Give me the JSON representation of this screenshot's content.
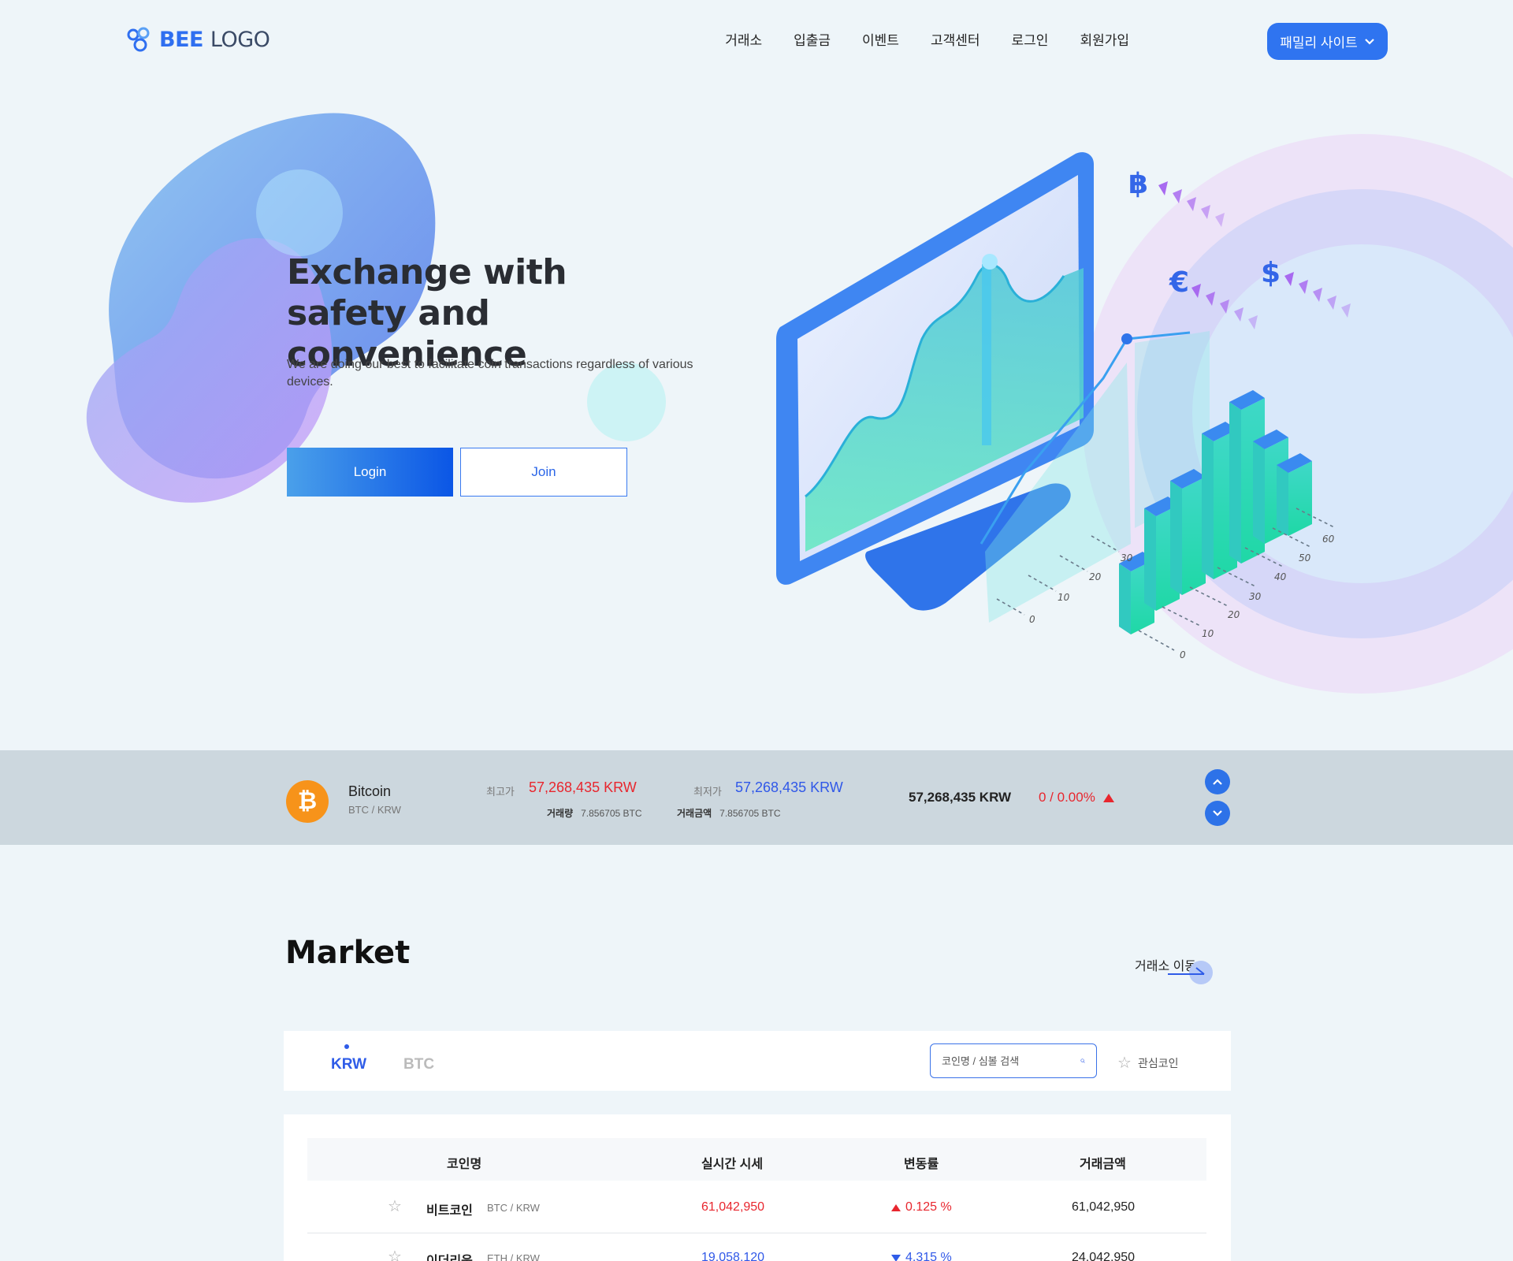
{
  "header": {
    "logo": {
      "bold": "BEE",
      "thin": "LOGO"
    },
    "nav": [
      "거래소",
      "입출금",
      "이벤트",
      "고객센터",
      "로그인",
      "회원가입"
    ],
    "family_site": "패밀리 사이트"
  },
  "hero": {
    "title_line1": "Exchange with",
    "title_line2": "safety and convenience",
    "subtitle": "We are doing our best to facilitate coin transactions regardless of various devices.",
    "login": "Login",
    "join": "Join",
    "axis_left": [
      "0",
      "10",
      "20",
      "30"
    ],
    "axis_right": [
      "0",
      "10",
      "20",
      "30",
      "40",
      "50",
      "60"
    ],
    "currency_symbols": [
      "฿",
      "€",
      "$"
    ]
  },
  "ticker": {
    "name": "Bitcoin",
    "pair": "BTC / KRW",
    "high_label": "최고가",
    "high_value": "57,268,435 KRW",
    "low_label": "최저가",
    "low_value": "57,268,435 KRW",
    "volume_label": "거래량",
    "volume_value": "7.856705 BTC",
    "amount_label": "거래금액",
    "amount_value": "7.856705 BTC",
    "price": "57,268,435 KRW",
    "change": "0 / 0.00%"
  },
  "market": {
    "title": "Market",
    "go_link": "거래소 이동",
    "tabs": [
      "KRW",
      "BTC"
    ],
    "search_placeholder": "코인명 / 심볼 검색",
    "favorites": "관심코인",
    "columns": [
      "코인명",
      "실시간 시세",
      "변동률",
      "거래금액"
    ],
    "rows": [
      {
        "name": "비트코인",
        "pair": "BTC / KRW",
        "price": "61,042,950",
        "change": "0.125 %",
        "direction": "up",
        "amount": "61,042,950"
      },
      {
        "name": "이더리움",
        "pair": "ETH / KRW",
        "price": "19,058,120",
        "change": "4,315 %",
        "direction": "down",
        "amount": "24,042,950"
      }
    ]
  },
  "colors": {
    "accent": "#2f74f0",
    "up": "#e8262e",
    "down": "#3058e8",
    "bitcoin": "#f7931a"
  }
}
